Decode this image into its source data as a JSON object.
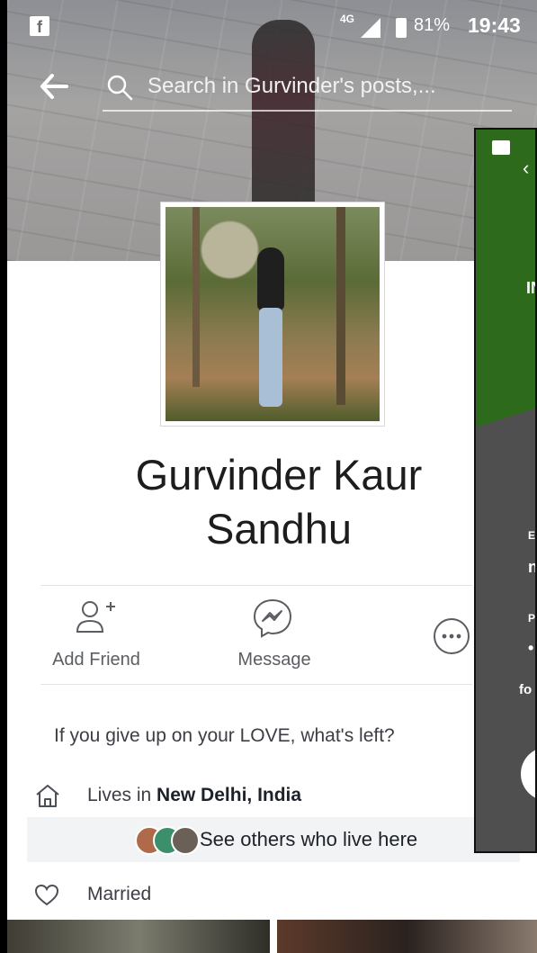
{
  "status_bar": {
    "network": "4G",
    "battery": "81%",
    "time": "19:43"
  },
  "search": {
    "placeholder": "Search in Gurvinder's posts,..."
  },
  "profile": {
    "name_line1": "Gurvinder Kaur",
    "name_line2": "Sandhu",
    "bio": "If you give up on your LOVE, what's left?"
  },
  "actions": {
    "add_friend": "Add Friend",
    "message": "Message"
  },
  "intro": {
    "lives_prefix": "Lives in ",
    "lives_place": "New Delhi, India",
    "see_others": "See others who live here",
    "relationship": "Married"
  },
  "overlay": {
    "heading_fragment": "IN",
    "label1": "E",
    "value1": "n",
    "label2": "P",
    "value2": "•",
    "link_fragment": "fo"
  },
  "colors": {
    "overlay_green": "#2d6a1c",
    "facebook_blue": "#3b5998"
  }
}
